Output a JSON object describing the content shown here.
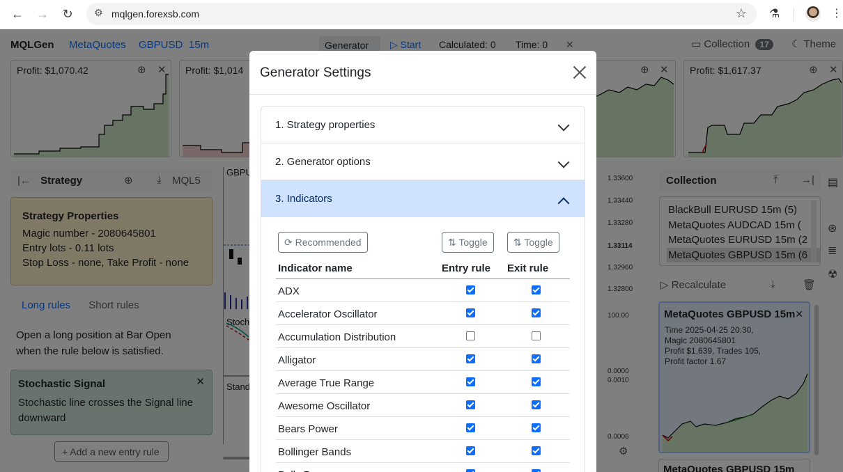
{
  "browser": {
    "url": "mqlgen.forexsb.com"
  },
  "app": {
    "brand": "MQLGen",
    "broker": "MetaQuotes",
    "symbol": "GBPUSD",
    "timeframe": "15m",
    "generator_label": "Generator",
    "start_label": "▷ Start",
    "calculated": "Calculated: 0",
    "time": "Time: 0",
    "collection_label": "Collection",
    "collection_count": "17",
    "theme_label": "Theme",
    "cards": [
      {
        "profit": "Profit: $1,070.42"
      },
      {
        "profit": "Profit: $1,014"
      },
      {
        "profit": "Profit: $1,617.37"
      }
    ],
    "strategy_panel": {
      "title": "Strategy",
      "mql5_label": "MQL5",
      "properties_title": "Strategy Properties",
      "magic": "Magic number - 2080645801",
      "lots": "Entry lots - 0.11 lots",
      "sl_tp": "Stop Loss - none, Take Profit - none",
      "long_tab": "Long rules",
      "short_tab": "Short rules",
      "rule_desc": "Open a long position at Bar Open when the rule below is satisfied.",
      "signal_title": "Stochastic Signal",
      "signal_desc": "Stochastic line crosses the Signal line downward",
      "add_rule": "+ Add a new entry rule"
    },
    "chart": {
      "label_gbp": "GBPU",
      "label_stoch": "Stoch",
      "label_stand": "Stand",
      "prices": [
        "1.33600",
        "1.33440",
        "1.33280",
        "1.33114",
        "1.32960",
        "1.32800",
        "100.00",
        "0.0000",
        "0.0010",
        "0.0006"
      ]
    },
    "collection_panel": {
      "title": "Collection",
      "items": [
        "BlackBull EURUSD 15m (5)",
        "MetaQuotes AUDCAD 15m (",
        "MetaQuotes EURUSD 15m (2",
        "MetaQuotes GBPUSD 15m (6"
      ],
      "recalculate": "Recalculate",
      "card_title": "MetaQuotes GBPUSD 15m",
      "card_time": "Time 2025-04-25 20:30,",
      "card_magic": "Magic 2080645801",
      "card_profit": "Profit $1,639, Trades 105,",
      "card_pf": "Profit factor 1.67",
      "card2_title": "MetaQuotes GBPUSD 15m"
    }
  },
  "modal": {
    "title": "Generator Settings",
    "sections": [
      {
        "label": "1. Strategy properties"
      },
      {
        "label": "2. Generator options"
      },
      {
        "label": "3. Indicators"
      }
    ],
    "recommended_label": "Recommended",
    "toggle_label": "Toggle",
    "col_name": "Indicator name",
    "col_entry": "Entry rule",
    "col_exit": "Exit rule",
    "indicators": [
      {
        "name": "ADX",
        "entry": true,
        "exit": true
      },
      {
        "name": "Accelerator Oscillator",
        "entry": true,
        "exit": true
      },
      {
        "name": "Accumulation Distribution",
        "entry": false,
        "exit": false
      },
      {
        "name": "Alligator",
        "entry": true,
        "exit": true
      },
      {
        "name": "Average True Range",
        "entry": true,
        "exit": true
      },
      {
        "name": "Awesome Oscillator",
        "entry": true,
        "exit": true
      },
      {
        "name": "Bears Power",
        "entry": true,
        "exit": true
      },
      {
        "name": "Bollinger Bands",
        "entry": true,
        "exit": true
      },
      {
        "name": "Bulls Power",
        "entry": true,
        "exit": true
      }
    ]
  },
  "colors": {
    "accent": "#0d6efd",
    "accordion_open": "#cfe2ff",
    "strategy_box": "#fff3cd",
    "signal_box": "#d1e7dd",
    "equity_line": "#000000",
    "equity_fill": "#cfe8c7"
  }
}
